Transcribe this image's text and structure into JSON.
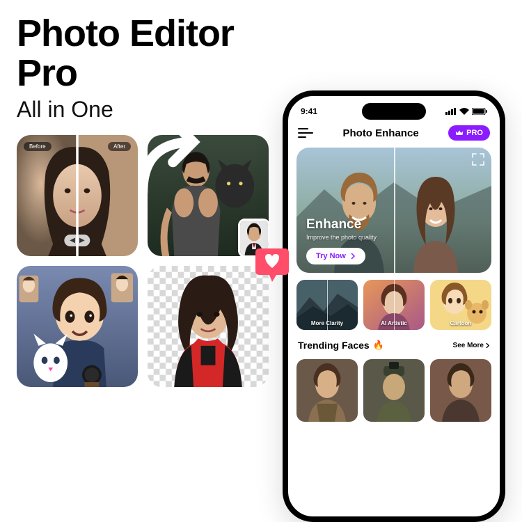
{
  "marketing": {
    "title": "Photo Editor Pro",
    "subtitle": "All in One",
    "tiles": {
      "before_after": {
        "before_label": "Before",
        "after_label": "After"
      },
      "face_swap": {
        "arrow_icon": "curved-arrow-icon"
      },
      "cartoon": {},
      "bg_remove": {}
    },
    "heart_icon": "heart-icon"
  },
  "phone": {
    "status": {
      "time": "9:41"
    },
    "appbar": {
      "menu_icon": "hamburger-icon",
      "title": "Photo Enhance",
      "pro_label": "PRO",
      "pro_icon": "crown-icon"
    },
    "hero": {
      "title": "Enhance",
      "subtitle": "Improve the photo quality",
      "cta_label": "Try Now",
      "expand_icon": "expand-arrows-icon"
    },
    "feature_cards": [
      {
        "label": "More Clarity"
      },
      {
        "label": "AI Artistic"
      },
      {
        "label": "Cartoon"
      }
    ],
    "trending": {
      "title": "Trending Faces",
      "fire_icon": "fire-icon",
      "see_more_label": "See More"
    }
  }
}
